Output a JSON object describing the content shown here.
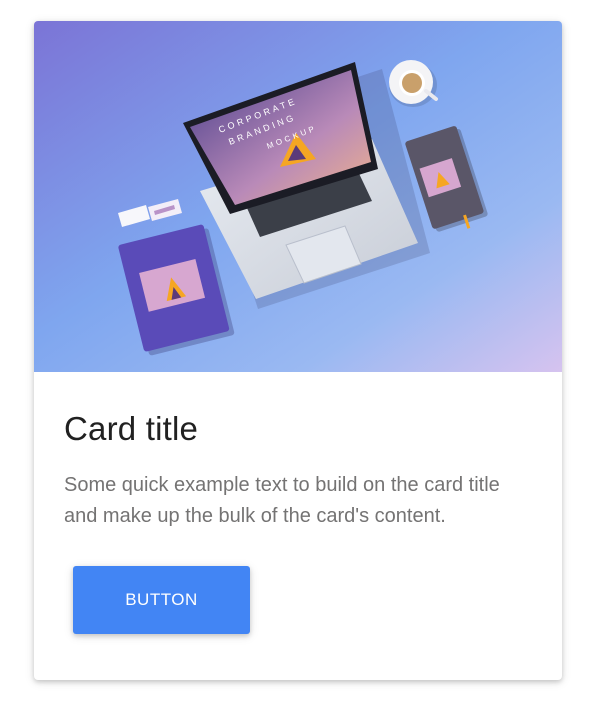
{
  "card": {
    "image": {
      "mockup_line1": "CORPORATE",
      "mockup_line2": "BRANDING",
      "mockup_line3": "MOCKUP"
    },
    "title": "Card title",
    "text": "Some quick example text to build on the card title and make up the bulk of the card's content.",
    "button_label": "BUTTON"
  },
  "colors": {
    "accent": "#4285f4",
    "title": "#212121",
    "body_text": "#747373"
  }
}
